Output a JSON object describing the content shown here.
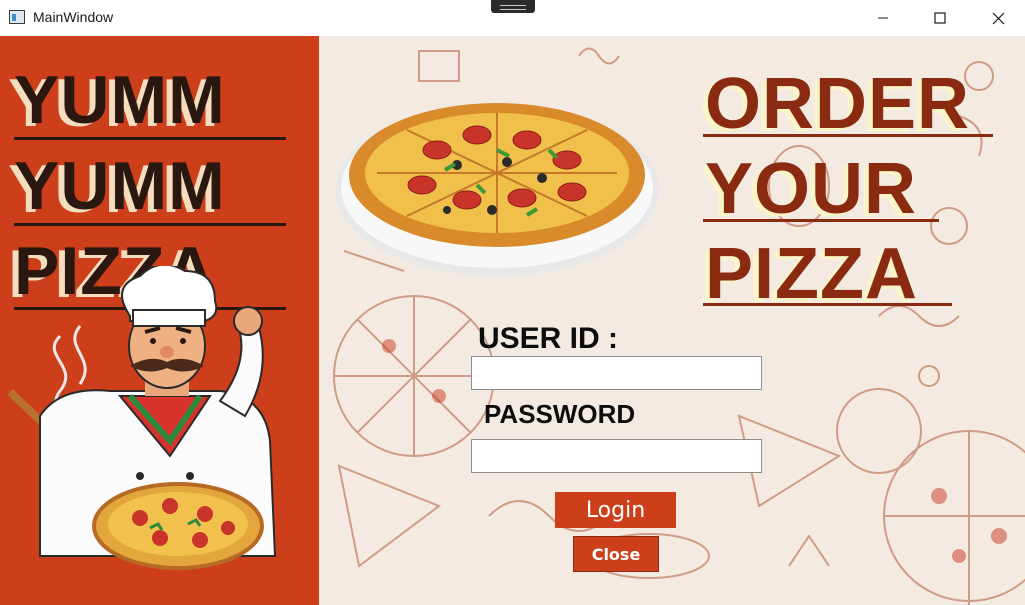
{
  "window": {
    "title": "MainWindow",
    "icon": "app-window-icon",
    "controls": [
      "minimize-icon",
      "maximize-icon",
      "close-icon"
    ]
  },
  "left_panel": {
    "background": "#cd3f1b",
    "brand_lines": [
      "YUMM",
      "YUMM",
      "PIZZA"
    ],
    "illustration": "chef-holding-pizza"
  },
  "main": {
    "heading_lines": [
      "ORDER",
      "YOUR",
      "PIZZA"
    ],
    "hero_image": "pizza-on-plate",
    "background_pattern": "pizza-doodle-pattern"
  },
  "login_form": {
    "user_id_label": "USER ID :",
    "user_id_value": "",
    "password_label": "PASSWORD",
    "password_value": "",
    "login_button": "Login",
    "close_button": "Close"
  },
  "colors": {
    "accent": "#cd3f1b",
    "heading": "#8a2a11",
    "brand_text": "#2a1810"
  }
}
